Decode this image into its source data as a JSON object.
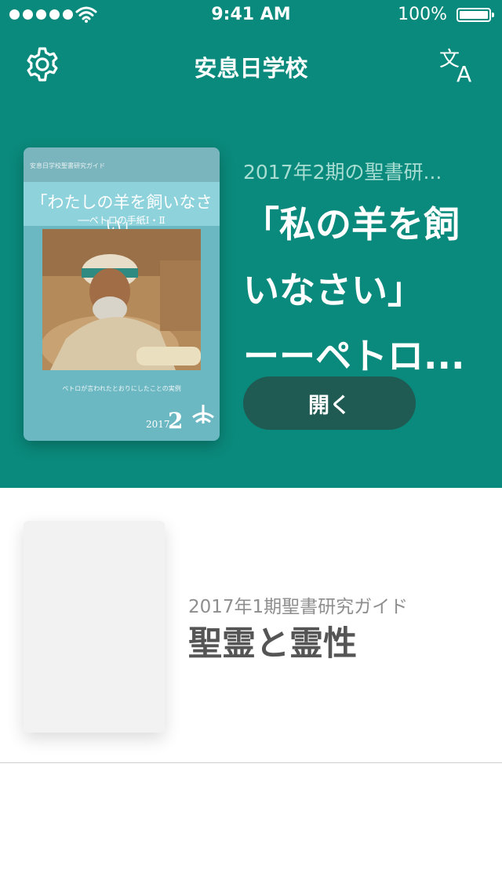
{
  "status_bar": {
    "time": "9:41 AM",
    "battery": "100%"
  },
  "nav": {
    "title": "安息日学校",
    "settings_icon": "gear-icon",
    "language_icon": "translate-icon"
  },
  "featured": {
    "cover": {
      "series": "安息日学校聖書研究ガイド",
      "title": "「わたしの羊を飼いなさい」",
      "subtitle": "──ペトロの手紙Ⅰ・Ⅱ",
      "caption": "ペトロが言われたとおりにしたことの実例",
      "year": "2017",
      "issue": "2"
    },
    "kicker": "2017年2期の聖書研...",
    "title_lines": [
      "「私の羊を飼",
      "いなさい」",
      "ーーペトロ..."
    ],
    "open_label": "開く"
  },
  "list": [
    {
      "kicker": "2017年1期聖書研究ガイド",
      "title": "聖霊と霊性"
    }
  ],
  "colors": {
    "primary": "#0a8a7c",
    "button": "#1f5a53",
    "kicker": "#a8ddd3"
  }
}
